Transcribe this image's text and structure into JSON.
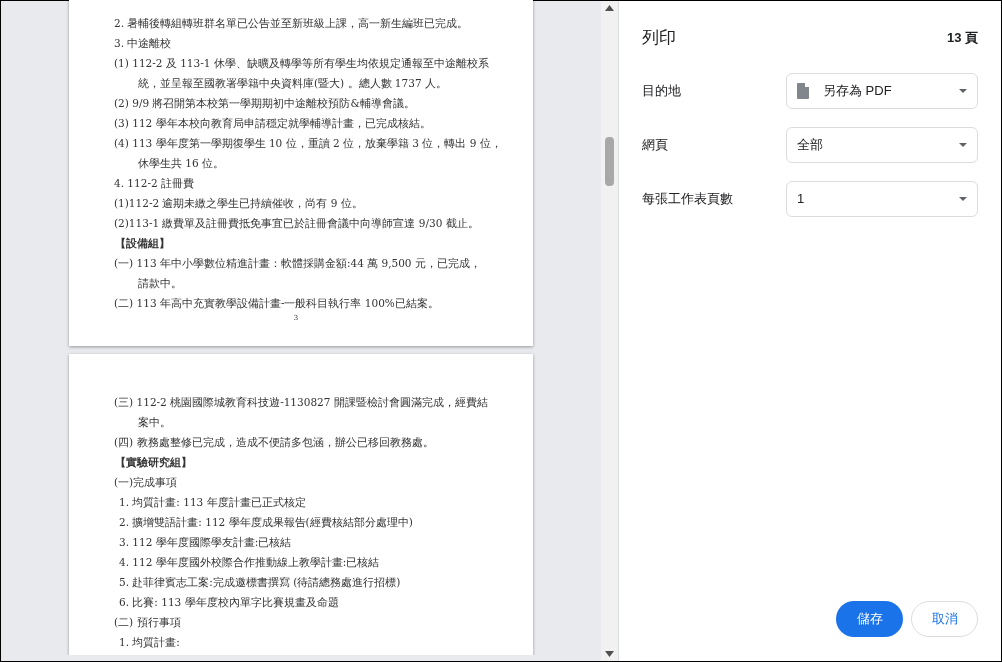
{
  "preview": {
    "pages": [
      {
        "lines": [
          {
            "kind": "text",
            "text": "2. 暑輔後轉組轉班群名單已公告並至新班級上課，高一新生編班已完成。"
          },
          {
            "kind": "text",
            "text": "3. 中途離校"
          },
          {
            "kind": "text",
            "text": "(1) 112-2 及 113-1 休學、缺曠及轉學等所有學生均依規定通報至中途離校系"
          },
          {
            "kind": "wrap",
            "text": "統，並呈報至國教署學籍中央資料庫(暨大) 。總人數 1737 人。"
          },
          {
            "kind": "text",
            "text": "(2) 9/9 將召開第本校第一學期期初中途離校預防&輔導會議。"
          },
          {
            "kind": "text",
            "text": "(3) 112 學年本校向教育局申請穩定就學輔導計畫，已完成核結。"
          },
          {
            "kind": "text",
            "text": "(4) 113 學年度第一學期復學生 10 位，重讀 2 位，放棄學籍 3 位，轉出 9 位，"
          },
          {
            "kind": "wrap",
            "text": "休學生共 16 位。"
          },
          {
            "kind": "text",
            "text": "4. 112-2 註冊費"
          },
          {
            "kind": "text",
            "text": " (1)112-2 逾期未繳之學生已持續催收，尚有 9 位。"
          },
          {
            "kind": "text",
            "text": " (2)113-1 繳費單及註冊費抵免事宜已於註冊會議中向導師宣達 9/30 截止。"
          },
          {
            "kind": "heading",
            "text": "【設備組】"
          },
          {
            "kind": "text",
            "text": "(一) 113 年中小學數位精進計畫：軟體採購金額:44 萬 9,500 元，已完成，"
          },
          {
            "kind": "wrap",
            "text": "請款中。"
          },
          {
            "kind": "text",
            "text": "(二) 113 年高中充實教學設備計畫-一般科目執行率 100%已結案。"
          },
          {
            "kind": "page_number",
            "text": "3"
          }
        ]
      },
      {
        "lines": [
          {
            "kind": "text",
            "text": "(三) 112-2 桃園國際城教育科技遊-1130827 開課暨檢討會圓滿完成，經費結"
          },
          {
            "kind": "wrap",
            "text": "案中。"
          },
          {
            "kind": "text",
            "text": "(四) 教務處整修已完成，造成不便請多包涵，辦公已移回教務處。"
          },
          {
            "kind": "heading",
            "text": "【實驗研究組】"
          },
          {
            "kind": "text",
            "text": "(一)完成事項"
          },
          {
            "kind": "sub",
            "text": "1. 均質計畫: 113 年度計畫已正式核定"
          },
          {
            "kind": "sub",
            "text": "2. 擴增雙語計畫: 112 學年度成果報告(經費核結部分處理中)"
          },
          {
            "kind": "sub",
            "text": "3. 112 學年度國際學友計畫:已核結"
          },
          {
            "kind": "sub",
            "text": "4. 112 學年度國外校際合作推動線上教學計畫:已核結"
          },
          {
            "kind": "sub",
            "text": "5. 赴菲律賓志工案:完成邀標書撰寫 (待請總務處進行招標)"
          },
          {
            "kind": "sub",
            "text": "6. 比賽: 113 學年度校內單字比賽規畫及命題"
          },
          {
            "kind": "text",
            "text": "(二) 預行事項"
          },
          {
            "kind": "sub",
            "text": "1. 均質計畫:"
          }
        ]
      }
    ]
  },
  "panel": {
    "title": "列印",
    "page_count": "13 頁",
    "settings": [
      {
        "label": "目的地",
        "value": "另存為 PDF",
        "kind": "destination"
      },
      {
        "label": "網頁",
        "value": "全部",
        "kind": "plain"
      },
      {
        "label": "每張工作表頁數",
        "value": "1",
        "kind": "plain"
      }
    ],
    "buttons": [
      {
        "label": "儲存",
        "kind": "primary"
      },
      {
        "label": "取消",
        "kind": "secondary"
      }
    ]
  }
}
